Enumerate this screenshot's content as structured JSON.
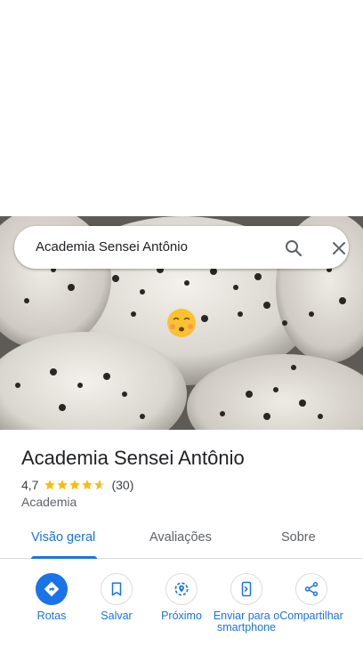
{
  "search": {
    "query": "Academia Sensei Antônio"
  },
  "place": {
    "name": "Academia Sensei Antônio",
    "rating": "4,7",
    "stars": 4.7,
    "review_count": "(30)",
    "category": "Academia"
  },
  "tabs": [
    {
      "label": "Visão geral",
      "active": true
    },
    {
      "label": "Avaliações",
      "active": false
    },
    {
      "label": "Sobre",
      "active": false
    }
  ],
  "actions": [
    {
      "label": "Rotas",
      "icon": "directions-icon"
    },
    {
      "label": "Salvar",
      "icon": "bookmark-icon"
    },
    {
      "label": "Próximo",
      "icon": "nearby-icon"
    },
    {
      "label": "Enviar para o smartphone",
      "icon": "send-to-phone-icon"
    },
    {
      "label": "Compartilhar",
      "icon": "share-icon"
    }
  ],
  "colors": {
    "accent": "#1a73e8",
    "star": "#fbbc04",
    "text": "#202124",
    "secondary": "#5f6368"
  }
}
